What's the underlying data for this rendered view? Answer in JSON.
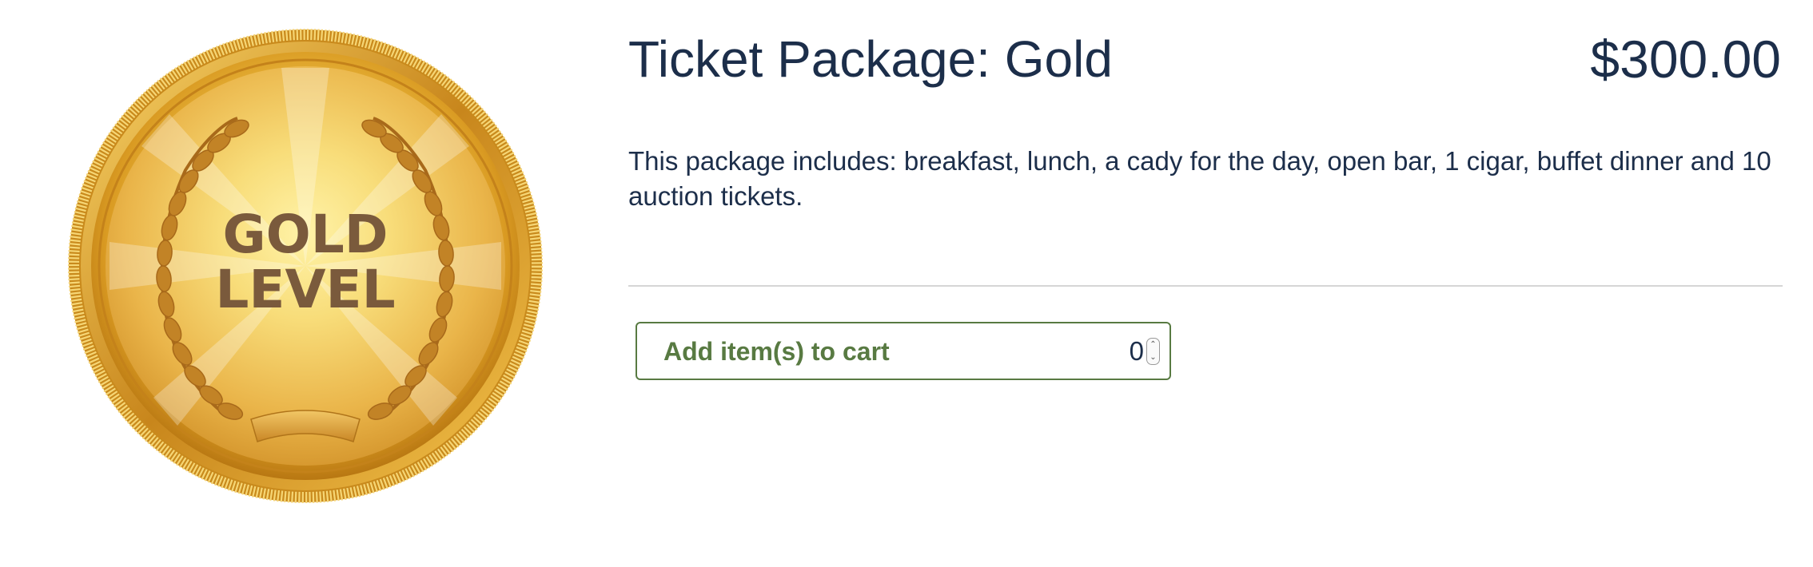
{
  "product": {
    "title": "Ticket Package: Gold",
    "price": "$300.00",
    "description": "This package includes: breakfast, lunch, a cady for the day, open bar, 1 cigar, buffet dinner and 10 auction tickets.",
    "image": {
      "icon": "gold-medal-icon",
      "text_line1": "GOLD",
      "text_line2": "LEVEL"
    }
  },
  "cart": {
    "button_label": "Add item(s) to cart",
    "quantity": "0"
  },
  "colors": {
    "text": "#1c2e4a",
    "button_border": "#587a42",
    "button_text": "#587a42",
    "divider": "#d6d6d6",
    "gold_light": "#fbe584",
    "gold_mid": "#e8b03a",
    "gold_dark": "#b57a12",
    "medal_text": "#7a5a3c"
  }
}
